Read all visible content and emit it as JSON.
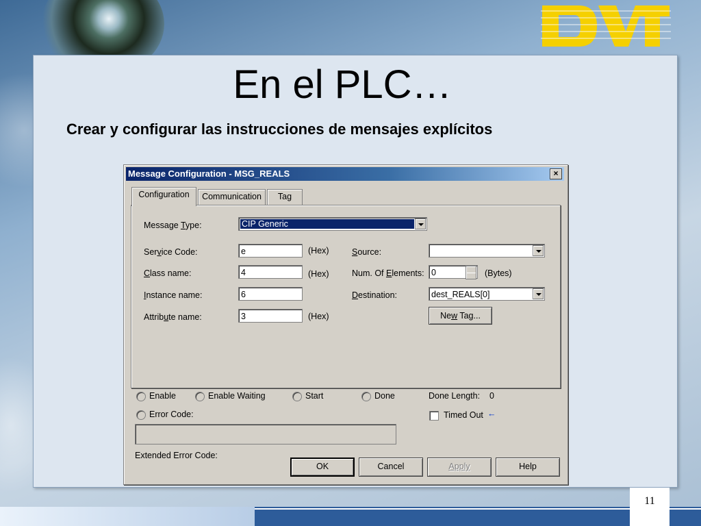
{
  "slide": {
    "title": "En el PLC…",
    "subtitle": "Crear y configurar las instrucciones de mensajes explícitos",
    "page_number": "11"
  },
  "dialog": {
    "title": "Message Configuration - MSG_REALS",
    "close": "×",
    "tabs": [
      {
        "label": "Configuration"
      },
      {
        "label": "Communication"
      },
      {
        "label": "Tag"
      }
    ],
    "message_type": {
      "label_pre": "Message ",
      "label_u": "T",
      "label_post": "ype:",
      "value": "CIP Generic"
    },
    "service_code": {
      "label_pre": "Ser",
      "label_u": "v",
      "label_post": "ice Code:",
      "value": "e",
      "unit": "(Hex)"
    },
    "class_name": {
      "label_u": "C",
      "label_post": "lass name:",
      "value": "4",
      "unit": "(Hex)"
    },
    "instance_name": {
      "label_u": "I",
      "label_post": "nstance name:",
      "value": "6"
    },
    "attribute_name": {
      "label_pre": "Attrib",
      "label_u": "u",
      "label_post": "te name:",
      "value": "3",
      "unit": "(Hex)"
    },
    "source": {
      "label_u": "S",
      "label_post": "ource:",
      "value": ""
    },
    "num_elements": {
      "label_pre": "Num. Of ",
      "label_u": "E",
      "label_post": "lements:",
      "value": "0",
      "unit": "(Bytes)"
    },
    "destination": {
      "label_u": "D",
      "label_post": "estination:",
      "value": "dest_REALS[0]"
    },
    "new_tag_button": {
      "label_pre": "Ne",
      "label_u": "w",
      "label_post": " Tag..."
    },
    "status": {
      "enable": "Enable",
      "enable_waiting": "Enable Waiting",
      "start": "Start",
      "done": "Done",
      "done_length_label": "Done Length:",
      "done_length_value": "0",
      "error_code": "Error Code:",
      "timed_out": "Timed Out",
      "timed_out_arrow": "←",
      "extended_error_code": "Extended Error Code:",
      "error_text": ""
    },
    "buttons": {
      "ok": "OK",
      "cancel": "Cancel",
      "apply": "Apply",
      "help": "Help"
    }
  },
  "colors": {
    "titlebar_start": "#0a246a",
    "dialog_face": "#d4d0c8",
    "logo_yellow": "#f5d000"
  }
}
